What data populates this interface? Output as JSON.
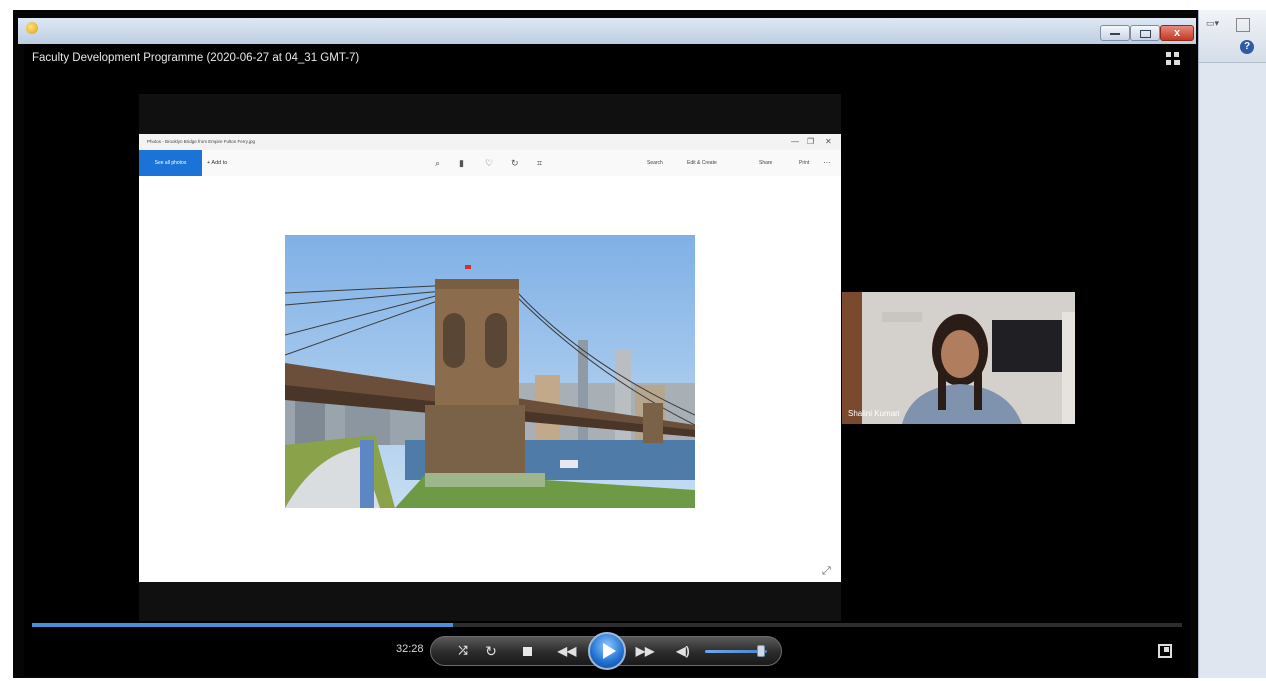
{
  "window": {
    "close_label": "x"
  },
  "player": {
    "video_title": "Faculty Development Programme (2020-06-27 at 04_31 GMT-7)",
    "elapsed_time": "32:28",
    "seek_progress_percent": 36.6,
    "volume_percent": 90,
    "shuffle_label": "⤮",
    "repeat_label": "↻",
    "prev_label": "◀◀",
    "next_label": "▶▶",
    "mute_label": "◀)"
  },
  "photos_app": {
    "title": "Photos - Brooklyn Bridge from Empire Fulton Ferry.jpg",
    "see_all_photos": "See all photos",
    "add_to": "+ Add to",
    "toolbar_right": [
      "Search",
      "Edit & Create",
      "Share",
      "Print"
    ],
    "minimize_label": "—",
    "restore_label": "❐",
    "close_label": "✕"
  },
  "participant": {
    "name": "Shalini Kumari"
  },
  "colors": {
    "accent": "#1b73d8",
    "seek_fill": "#4a90d9"
  }
}
